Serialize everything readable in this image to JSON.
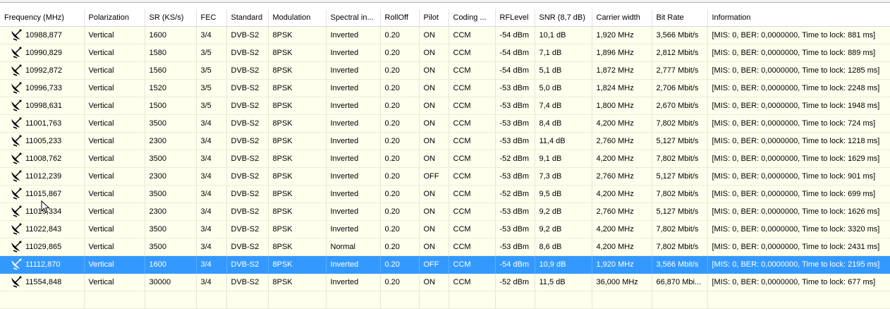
{
  "columns": [
    "Frequency (MHz)",
    "Polarization",
    "SR (KS/s)",
    "FEC",
    "Standard",
    "Modulation",
    "Spectral in...",
    "RollOff",
    "Pilot",
    "Coding ...",
    "RFLevel",
    "SNR (8,7 dB)",
    "Carrier width",
    "Bit Rate",
    "Information"
  ],
  "rows": [
    {
      "freq": "10988,877",
      "pol": "Vertical",
      "sr": "1600",
      "fec": "3/4",
      "std": "DVB-S2",
      "mod": "8PSK",
      "spec": "Inverted",
      "roll": "0.20",
      "pilot": "ON",
      "coding": "CCM",
      "rf": "-54 dBm",
      "snr": "10,1 dB",
      "cw": "1,920 MHz",
      "br": "3,566 Mbit/s",
      "info": "[MIS: 0, BER: 0,0000000, Time to lock: 881 ms]"
    },
    {
      "freq": "10990,829",
      "pol": "Vertical",
      "sr": "1580",
      "fec": "3/5",
      "std": "DVB-S2",
      "mod": "8PSK",
      "spec": "Inverted",
      "roll": "0.20",
      "pilot": "ON",
      "coding": "CCM",
      "rf": "-54 dBm",
      "snr": "7,1 dB",
      "cw": "1,896 MHz",
      "br": "2,812 Mbit/s",
      "info": "[MIS: 0, BER: 0,0000000, Time to lock: 889 ms]"
    },
    {
      "freq": "10992,872",
      "pol": "Vertical",
      "sr": "1560",
      "fec": "3/5",
      "std": "DVB-S2",
      "mod": "8PSK",
      "spec": "Inverted",
      "roll": "0.20",
      "pilot": "ON",
      "coding": "CCM",
      "rf": "-54 dBm",
      "snr": "5,1 dB",
      "cw": "1,872 MHz",
      "br": "2,777 Mbit/s",
      "info": "[MIS: 0, BER: 0,0000000, Time to lock: 1285 ms]"
    },
    {
      "freq": "10996,733",
      "pol": "Vertical",
      "sr": "1520",
      "fec": "3/5",
      "std": "DVB-S2",
      "mod": "8PSK",
      "spec": "Inverted",
      "roll": "0.20",
      "pilot": "ON",
      "coding": "CCM",
      "rf": "-53 dBm",
      "snr": "5,0 dB",
      "cw": "1,824 MHz",
      "br": "2,706 Mbit/s",
      "info": "[MIS: 0, BER: 0,0000000, Time to lock: 2248 ms]"
    },
    {
      "freq": "10998,631",
      "pol": "Vertical",
      "sr": "1500",
      "fec": "3/5",
      "std": "DVB-S2",
      "mod": "8PSK",
      "spec": "Inverted",
      "roll": "0.20",
      "pilot": "ON",
      "coding": "CCM",
      "rf": "-53 dBm",
      "snr": "7,4 dB",
      "cw": "1,800 MHz",
      "br": "2,670 Mbit/s",
      "info": "[MIS: 0, BER: 0,0000000, Time to lock: 1948 ms]"
    },
    {
      "freq": "11001,763",
      "pol": "Vertical",
      "sr": "3500",
      "fec": "3/4",
      "std": "DVB-S2",
      "mod": "8PSK",
      "spec": "Inverted",
      "roll": "0.20",
      "pilot": "ON",
      "coding": "CCM",
      "rf": "-53 dBm",
      "snr": "8,4 dB",
      "cw": "4,200 MHz",
      "br": "7,802 Mbit/s",
      "info": "[MIS: 0, BER: 0,0000000, Time to lock: 724 ms]"
    },
    {
      "freq": "11005,233",
      "pol": "Vertical",
      "sr": "2300",
      "fec": "3/4",
      "std": "DVB-S2",
      "mod": "8PSK",
      "spec": "Inverted",
      "roll": "0.20",
      "pilot": "ON",
      "coding": "CCM",
      "rf": "-53 dBm",
      "snr": "11,4 dB",
      "cw": "2,760 MHz",
      "br": "5,127 Mbit/s",
      "info": "[MIS: 0, BER: 0,0000000, Time to lock: 1218 ms]"
    },
    {
      "freq": "11008,762",
      "pol": "Vertical",
      "sr": "3500",
      "fec": "3/4",
      "std": "DVB-S2",
      "mod": "8PSK",
      "spec": "Inverted",
      "roll": "0.20",
      "pilot": "ON",
      "coding": "CCM",
      "rf": "-52 dBm",
      "snr": "9,1 dB",
      "cw": "4,200 MHz",
      "br": "7,802 Mbit/s",
      "info": "[MIS: 0, BER: 0,0000000, Time to lock: 1629 ms]"
    },
    {
      "freq": "11012,239",
      "pol": "Vertical",
      "sr": "2300",
      "fec": "3/4",
      "std": "DVB-S2",
      "mod": "8PSK",
      "spec": "Inverted",
      "roll": "0.20",
      "pilot": "OFF",
      "coding": "CCM",
      "rf": "-53 dBm",
      "snr": "7,3 dB",
      "cw": "2,760 MHz",
      "br": "5,127 Mbit/s",
      "info": "[MIS: 0, BER: 0,0000000, Time to lock: 901 ms]"
    },
    {
      "freq": "11015,867",
      "pol": "Vertical",
      "sr": "3500",
      "fec": "3/4",
      "std": "DVB-S2",
      "mod": "8PSK",
      "spec": "Inverted",
      "roll": "0.20",
      "pilot": "ON",
      "coding": "CCM",
      "rf": "-52 dBm",
      "snr": "9,5 dB",
      "cw": "4,200 MHz",
      "br": "7,802 Mbit/s",
      "info": "[MIS: 0, BER: 0,0000000, Time to lock: 699 ms]"
    },
    {
      "freq": "11019,334",
      "pol": "Vertical",
      "sr": "2300",
      "fec": "3/4",
      "std": "DVB-S2",
      "mod": "8PSK",
      "spec": "Inverted",
      "roll": "0.20",
      "pilot": "ON",
      "coding": "CCM",
      "rf": "-53 dBm",
      "snr": "9,2 dB",
      "cw": "2,760 MHz",
      "br": "5,127 Mbit/s",
      "info": "[MIS: 0, BER: 0,0000000, Time to lock: 1626 ms]"
    },
    {
      "freq": "11022,843",
      "pol": "Vertical",
      "sr": "3500",
      "fec": "3/4",
      "std": "DVB-S2",
      "mod": "8PSK",
      "spec": "Inverted",
      "roll": "0.20",
      "pilot": "ON",
      "coding": "CCM",
      "rf": "-53 dBm",
      "snr": "9,2 dB",
      "cw": "4,200 MHz",
      "br": "7,802 Mbit/s",
      "info": "[MIS: 0, BER: 0,0000000, Time to lock: 3320 ms]"
    },
    {
      "freq": "11029,865",
      "pol": "Vertical",
      "sr": "3500",
      "fec": "3/4",
      "std": "DVB-S2",
      "mod": "8PSK",
      "spec": "Normal",
      "roll": "0.20",
      "pilot": "ON",
      "coding": "CCM",
      "rf": "-53 dBm",
      "snr": "8,6 dB",
      "cw": "4,200 MHz",
      "br": "7,802 Mbit/s",
      "info": "[MIS: 0, BER: 0,0000000, Time to lock: 2431 ms]"
    },
    {
      "freq": "11112,870",
      "pol": "Vertical",
      "sr": "1600",
      "fec": "3/4",
      "std": "DVB-S2",
      "mod": "8PSK",
      "spec": "Inverted",
      "roll": "0.20",
      "pilot": "OFF",
      "coding": "CCM",
      "rf": "-54 dBm",
      "snr": "10,9 dB",
      "cw": "1,920 MHz",
      "br": "3,566 Mbit/s",
      "info": "[MIS: 0, BER: 0,0000000, Time to lock: 2195 ms]",
      "selected": true
    },
    {
      "freq": "11554,848",
      "pol": "Vertical",
      "sr": "30000",
      "fec": "3/4",
      "std": "DVB-S2",
      "mod": "8PSK",
      "spec": "Inverted",
      "roll": "0.20",
      "pilot": "ON",
      "coding": "CCM",
      "rf": "-52 dBm",
      "snr": "11,5 dB",
      "cw": "36,000 MHz",
      "br": "66,870 Mbi...",
      "info": "[MIS: 0, BER: 0,0000000, Time to lock: 677 ms]"
    }
  ],
  "row_icon": "satellite-dish-icon",
  "colors": {
    "row_bg": "#ffffee",
    "selected_bg": "#3399ff",
    "selected_text": "#ffffff",
    "header_bg": "#ffffff"
  }
}
